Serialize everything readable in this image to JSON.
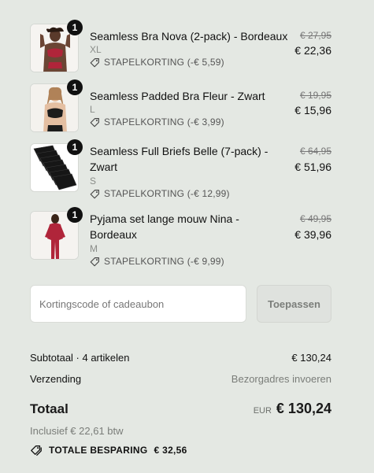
{
  "items": [
    {
      "quantity": "1",
      "name": "Seamless Bra Nova (2-pack) - Bordeaux",
      "variant": "XL",
      "discount": "STAPELKORTING (-€ 5,59)",
      "old_price": "€ 27,95",
      "price": "€ 22,36"
    },
    {
      "quantity": "1",
      "name": "Seamless Padded Bra Fleur - Zwart",
      "variant": "L",
      "discount": "STAPELKORTING (-€ 3,99)",
      "old_price": "€ 19,95",
      "price": "€ 15,96"
    },
    {
      "quantity": "1",
      "name": "Seamless Full Briefs Belle (7-pack) - Zwart",
      "variant": "S",
      "discount": "STAPELKORTING (-€ 12,99)",
      "old_price": "€ 64,95",
      "price": "€ 51,96"
    },
    {
      "quantity": "1",
      "name": "Pyjama set lange mouw Nina - Bordeaux",
      "variant": "M",
      "discount": "STAPELKORTING (-€ 9,99)",
      "old_price": "€ 49,95",
      "price": "€ 39,96"
    }
  ],
  "discount_code": {
    "placeholder": "Kortingscode of cadeaubon",
    "value": "",
    "apply_label": "Toepassen"
  },
  "summary": {
    "subtotal_label": "Subtotaal · 4 artikelen",
    "subtotal_value": "€ 130,24",
    "shipping_label": "Verzending",
    "shipping_value": "Bezorgadres invoeren",
    "total_label": "Totaal",
    "total_currency": "EUR",
    "total_value": "€ 130,24",
    "tax_note": "Inclusief € 22,61 btw",
    "savings_label": "TOTALE BESPARING",
    "savings_value": "€ 32,56"
  },
  "colors": {
    "background": "#e4e8e3",
    "text": "#1a1a1a",
    "muted": "#7a7d79",
    "bordeaux": "#b0253a"
  }
}
